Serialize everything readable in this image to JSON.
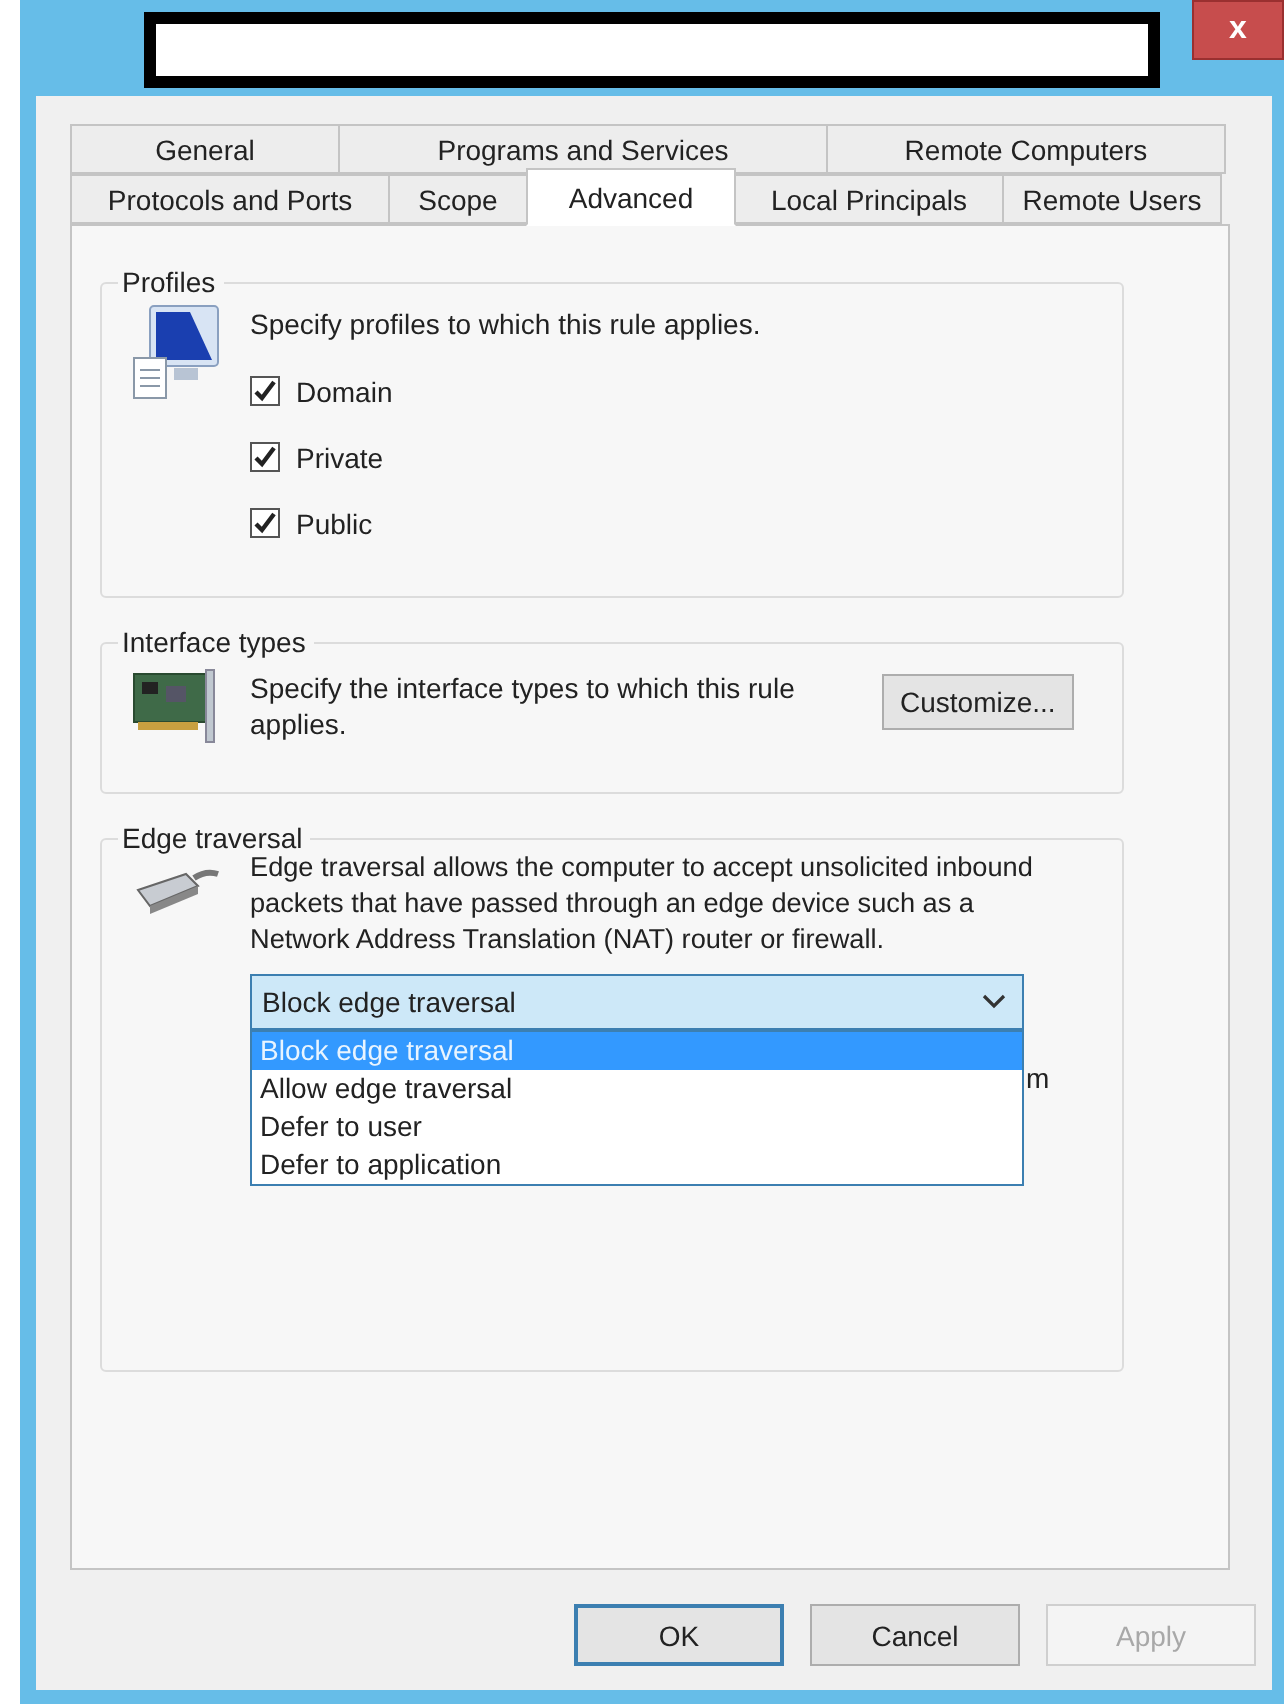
{
  "window": {
    "close_button": "x"
  },
  "tab_rows": [
    [
      {
        "label": "General",
        "selected": false
      },
      {
        "label": "Programs and Services",
        "selected": false
      },
      {
        "label": "Remote Computers",
        "selected": false
      }
    ],
    [
      {
        "label": "Protocols and Ports",
        "selected": false
      },
      {
        "label": "Scope",
        "selected": false
      },
      {
        "label": "Advanced",
        "selected": true
      },
      {
        "label": "Local Principals",
        "selected": false
      },
      {
        "label": "Remote Users",
        "selected": false
      }
    ]
  ],
  "profiles": {
    "title": "Profiles",
    "description": "Specify profiles to which this rule applies.",
    "checkboxes": [
      {
        "label": "Domain",
        "checked": true
      },
      {
        "label": "Private",
        "checked": true
      },
      {
        "label": "Public",
        "checked": true
      }
    ]
  },
  "interface_types": {
    "title": "Interface types",
    "description": "Specify the interface types to which this rule applies.",
    "button": "Customize..."
  },
  "edge_traversal": {
    "title": "Edge traversal",
    "description": "Edge traversal allows the computer to accept unsolicited inbound packets that have passed through an edge device such as a Network Address Translation (NAT) router or firewall.",
    "dropdown": {
      "value": "Block edge traversal",
      "expanded": true,
      "options": [
        {
          "label": "Block edge traversal",
          "selected": true
        },
        {
          "label": "Allow edge traversal",
          "selected": false
        },
        {
          "label": "Defer to user",
          "selected": false
        },
        {
          "label": "Defer to application",
          "selected": false
        }
      ]
    },
    "covered_text": "m"
  },
  "buttons": [
    {
      "label": "OK",
      "default": true,
      "disabled": false
    },
    {
      "label": "Cancel",
      "default": false,
      "disabled": false
    },
    {
      "label": "Apply",
      "default": false,
      "disabled": true
    }
  ]
}
